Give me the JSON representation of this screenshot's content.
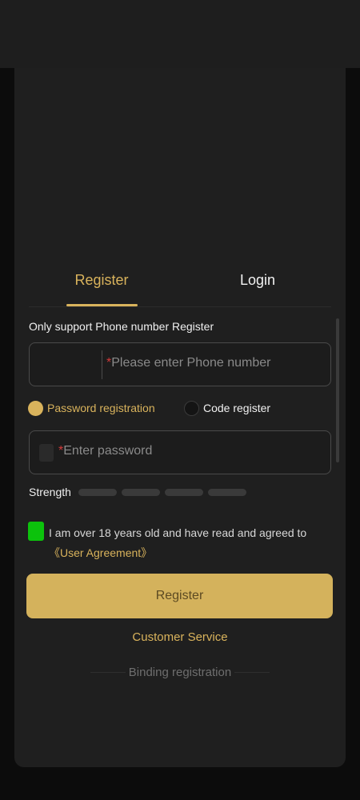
{
  "tabs": {
    "register": "Register",
    "login": "Login"
  },
  "form": {
    "support_text": "Only support Phone number Register",
    "phone_required_mark": "*",
    "phone_placeholder": "Please enter Phone number",
    "modes": {
      "password": "Password registration",
      "code": "Code register"
    },
    "password_required_mark": "*",
    "password_placeholder": "Enter password",
    "strength_label": "Strength",
    "agreement_text": "I am over 18 years old and have read and agreed to ",
    "agreement_link": "《User Agreement》",
    "submit_label": "Register"
  },
  "footer": {
    "customer_service": "Customer Service",
    "binding_registration": "Binding registration"
  },
  "colors": {
    "accent": "#d9b35c",
    "checkbox": "#0cc20c",
    "background": "#1f1f1f"
  }
}
